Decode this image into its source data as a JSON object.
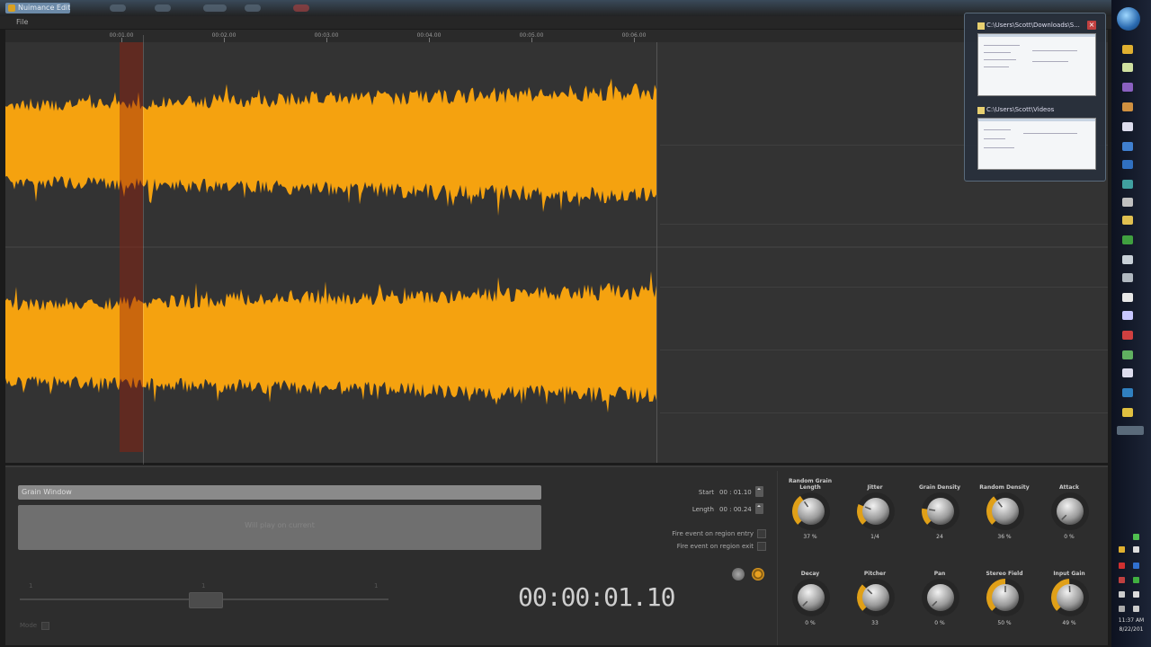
{
  "window": {
    "title": "Nuimance Editor",
    "menu": {
      "file_label": "File"
    }
  },
  "ruler": {
    "ticks": [
      "00:01.00",
      "00:02.00",
      "00:03.00",
      "00:04.00",
      "00:05.00",
      "00:06.00"
    ]
  },
  "grain_window": {
    "header": "Grain Window",
    "display_text": "Will play on current"
  },
  "slider": {
    "mode_label": "Mode"
  },
  "region": {
    "start_label": "Start",
    "start_value": "00 : 01.10",
    "length_label": "Length",
    "length_value": "00 : 00.24",
    "checkbox1_label": "Fire event on region entry",
    "checkbox2_label": "Fire event on region exit"
  },
  "transport": {
    "timecode": "00:00:01.10"
  },
  "knobs": [
    {
      "label": "Random Grain Length",
      "value": "37 %",
      "level": 0.37
    },
    {
      "label": "Jitter",
      "value": "1/4",
      "level": 0.25
    },
    {
      "label": "Grain Density",
      "value": "24",
      "level": 0.2
    },
    {
      "label": "Random Density",
      "value": "36 %",
      "level": 0.36
    },
    {
      "label": "Attack",
      "value": "0 %",
      "level": 0.0
    },
    {
      "label": "Decay",
      "value": "0 %",
      "level": 0.0
    },
    {
      "label": "Pitcher",
      "value": "33",
      "level": 0.33
    },
    {
      "label": "Pan",
      "value": "0 %",
      "level": 0.0
    },
    {
      "label": "Stereo Field",
      "value": "50 %",
      "level": 0.5
    },
    {
      "label": "Input Gain",
      "value": "49 %",
      "level": 0.49
    }
  ],
  "thumbnails": [
    {
      "title": "C:\\Users\\Scott\\Downloads\\S..."
    },
    {
      "title": "C:\\Users\\Scott\\Videos"
    }
  ],
  "taskbar": {
    "clock_time": "11:37 AM",
    "clock_date": "8/22/201"
  },
  "colors": {
    "waveform": "#f5a20f",
    "selection": "#8c1e0a",
    "knob_arc": "#e0a018",
    "panel": "#2d2d2d"
  }
}
